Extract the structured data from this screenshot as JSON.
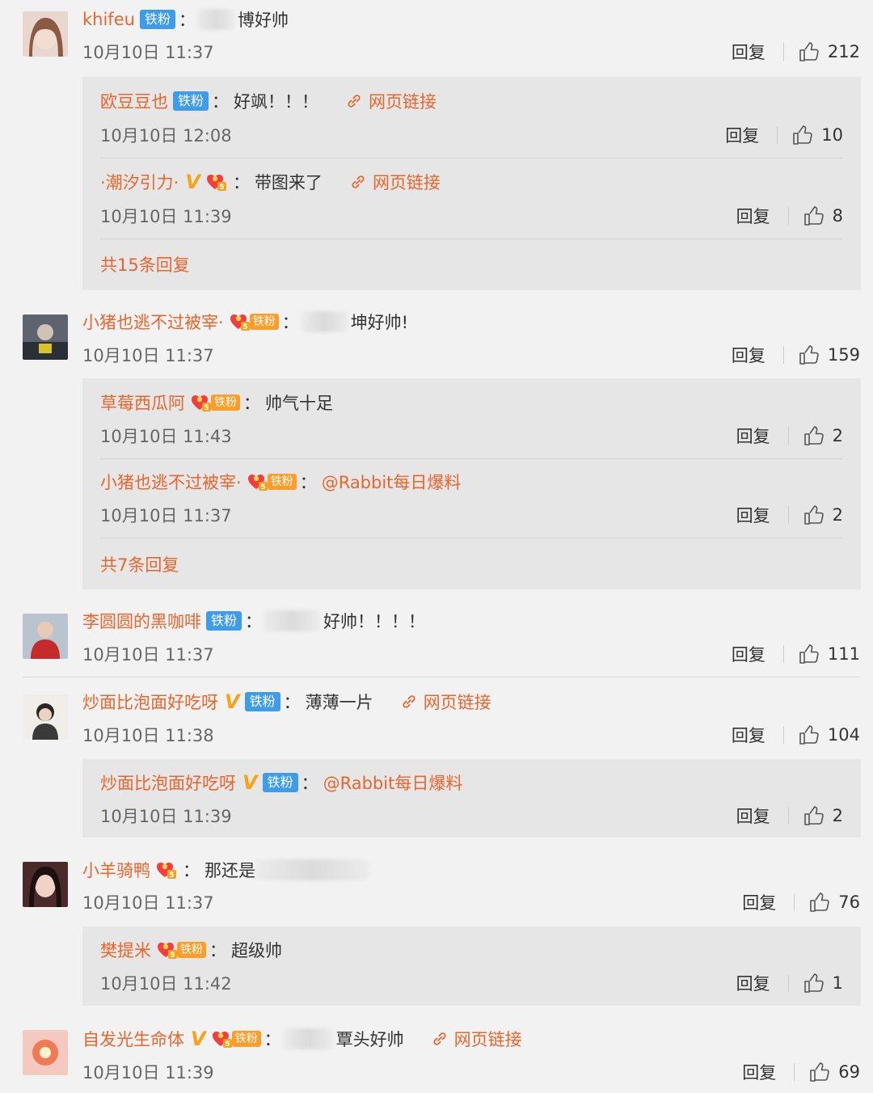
{
  "labels": {
    "reply": "回复",
    "web_link": "网页链接",
    "tie_fan": "铁粉",
    "colon": "："
  },
  "comments": [
    {
      "user": "khifeu",
      "content": "博好帅",
      "date": "10月10日 11:37",
      "likes": "212",
      "replies": [
        {
          "user": "欧豆豆也",
          "content": "好飒！！！",
          "date": "10月10日 12:08",
          "likes": "10"
        },
        {
          "user": "·潮汐引力·",
          "content": "带图来了",
          "date": "10月10日 11:39",
          "likes": "8"
        }
      ],
      "more": "共15条回复"
    },
    {
      "user": "小猪也逃不过被宰·",
      "content": "坤好帅!",
      "date": "10月10日 11:37",
      "likes": "159",
      "replies": [
        {
          "user": "草莓西瓜阿",
          "content": "帅气十足",
          "date": "10月10日 11:43",
          "likes": "2"
        },
        {
          "user": "小猪也逃不过被宰·",
          "content": "@Rabbit每日爆料",
          "date": "10月10日 11:37",
          "likes": "2"
        }
      ],
      "more": "共7条回复"
    },
    {
      "user": "李圆圆的黑咖啡",
      "content": "好帅！！！！",
      "date": "10月10日 11:37",
      "likes": "111"
    },
    {
      "user": "炒面比泡面好吃呀",
      "content": "薄薄一片",
      "date": "10月10日 11:38",
      "likes": "104",
      "replies": [
        {
          "user": "炒面比泡面好吃呀",
          "content": "@Rabbit每日爆料",
          "date": "10月10日 11:39",
          "likes": "2"
        }
      ]
    },
    {
      "user": "小羊骑鸭",
      "content": "那还是",
      "date": "10月10日 11:37",
      "likes": "76",
      "replies": [
        {
          "user": "樊提米",
          "content": "超级帅",
          "date": "10月10日 11:42",
          "likes": "1"
        }
      ]
    },
    {
      "user": "自发光生命体",
      "content": "覃头好帅",
      "date": "10月10日 11:39",
      "likes": "69"
    }
  ],
  "colors": {
    "username": "#e8652d",
    "background": "#f2f2f2",
    "reply_box": "#e6e6e6",
    "tie_badge": "#3f9ce8",
    "fan_badge": "#ff9d2a",
    "verified": "#f7a21b"
  },
  "icons": [
    "thumbs-up-icon",
    "link-icon",
    "verified-v-icon",
    "fan-heart-icon"
  ]
}
